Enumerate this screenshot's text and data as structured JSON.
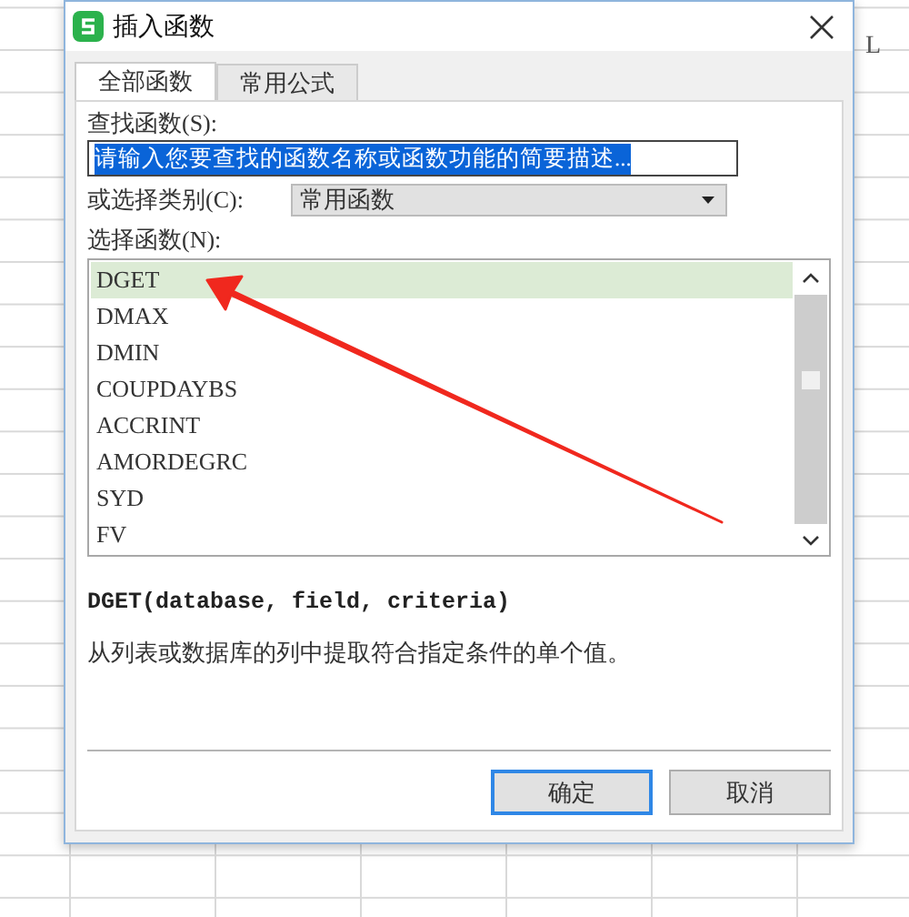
{
  "spreadsheet": {
    "column_header": "L"
  },
  "window": {
    "title": "插入函数"
  },
  "tabs": [
    {
      "label": "全部函数",
      "selected": true
    },
    {
      "label": "常用公式",
      "selected": false
    }
  ],
  "search": {
    "label": "查找函数(S):",
    "value": "请输入您要查找的函数名称或函数功能的简要描述...",
    "highlighted": true
  },
  "category": {
    "label": "或选择类别(C):",
    "value": "常用函数"
  },
  "function_list": {
    "label": "选择函数(N):",
    "items": [
      {
        "name": "DGET",
        "selected": true
      },
      {
        "name": "DMAX",
        "selected": false
      },
      {
        "name": "DMIN",
        "selected": false
      },
      {
        "name": "COUPDAYBS",
        "selected": false
      },
      {
        "name": "ACCRINT",
        "selected": false
      },
      {
        "name": "AMORDEGRC",
        "selected": false
      },
      {
        "name": "SYD",
        "selected": false
      },
      {
        "name": "FV",
        "selected": false
      }
    ]
  },
  "signature": "DGET(database, field, criteria)",
  "description": "从列表或数据库的列中提取符合指定条件的单个值。",
  "buttons": [
    {
      "label": "确定",
      "default": true
    },
    {
      "label": "取消",
      "default": false
    }
  ]
}
